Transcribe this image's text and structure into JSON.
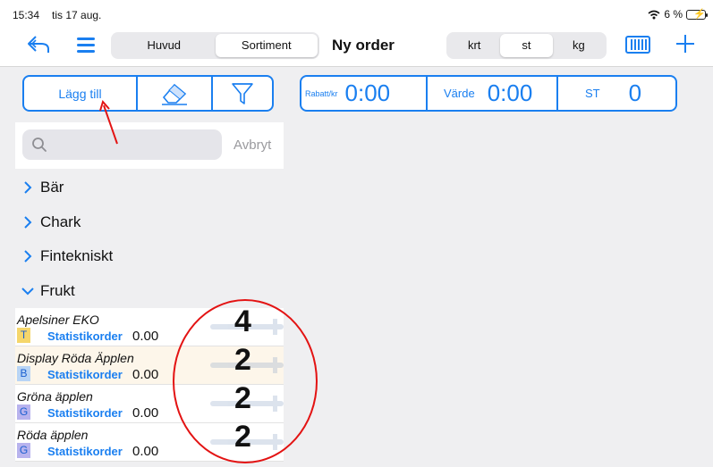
{
  "status": {
    "time": "15:34",
    "date": "tis 17 aug.",
    "battery": "6 %"
  },
  "nav": {
    "segments": [
      "Huvud",
      "Sortiment"
    ],
    "active_segment": "Sortiment",
    "title": "Ny order",
    "units": [
      "krt",
      "st",
      "kg"
    ],
    "active_unit": "st"
  },
  "toolbar": {
    "add_label": "Lägg till"
  },
  "summary": {
    "rabatt_label": "Rabatt/kr",
    "rabatt_value": "0:00",
    "varde_label": "Värde",
    "varde_value": "0:00",
    "st_label": "ST",
    "st_value": "0"
  },
  "search": {
    "placeholder": "",
    "cancel_label": "Avbryt"
  },
  "categories": [
    "Bär",
    "Chark",
    "Fintekniskt",
    "Frukt"
  ],
  "items": [
    {
      "name": "Apelsiner EKO",
      "badge": "T",
      "badge_color": "#f5d66b",
      "stat_label": "Statistikorder",
      "price": "0.00",
      "qty": "4"
    },
    {
      "name": "Display Röda Äpplen",
      "badge": "B",
      "badge_color": "#b8d4f5",
      "stat_label": "Statistikorder",
      "price": "0.00",
      "qty": "2"
    },
    {
      "name": "Gröna äpplen",
      "badge": "G",
      "badge_color": "#b8b3ee",
      "stat_label": "Statistikorder",
      "price": "0.00",
      "qty": "2"
    },
    {
      "name": "Röda äpplen",
      "badge": "G",
      "badge_color": "#b8b3ee",
      "stat_label": "Statistikorder",
      "price": "0.00",
      "qty": "2"
    }
  ],
  "colors": {
    "accent": "#1a7ff0",
    "annotation": "#e31313"
  }
}
